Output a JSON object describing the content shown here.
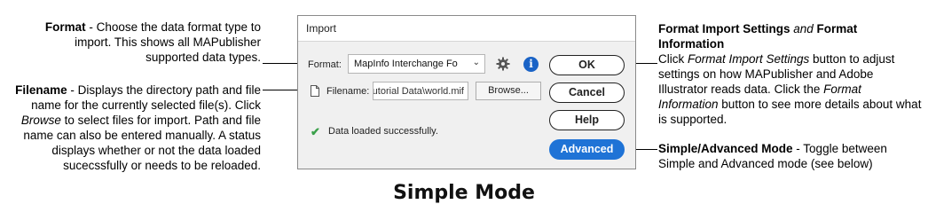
{
  "callouts": {
    "format": {
      "title": "Format",
      "text": " - Choose the data format type to import. This shows all MAPublisher supported data types."
    },
    "filename": {
      "title": "Filename",
      "text_1": " - Displays the directory path and file name for the currently selected file(s). Click ",
      "browse_em": "Browse",
      "text_2": " to select files for import. Path and file name can also be entered manually. A status displays whether or not the data loaded sucecssfully or needs to be reloaded."
    },
    "format_info": {
      "title_1": "Format Import Settings",
      "and": " and ",
      "title_2": "Format Information",
      "text_1": "Click ",
      "em_1": "Format Import Settings",
      "text_2": " button to adjust settings on how MAPublisher and Adobe Illustrator reads data. Click the ",
      "em_2": "Format Information",
      "text_3": " button to see more details about what is supported."
    },
    "mode": {
      "title": "Simple/Advanced Mode",
      "text": " - Toggle between Simple and Advanced mode (see below)"
    }
  },
  "dialog": {
    "title": "Import",
    "format_label": "Format:",
    "format_value": "MapInfo Interchange Fo",
    "filename_label": "Filename:",
    "filename_value": "utorial Data\\world.mif",
    "browse_label": "Browse...",
    "status_text": "Data loaded successfully.",
    "buttons": {
      "ok": "OK",
      "cancel": "Cancel",
      "help": "Help",
      "advanced": "Advanced"
    }
  },
  "caption": "Simple Mode",
  "icons": [
    "gear-icon",
    "info-icon",
    "file-icon",
    "checkmark-icon",
    "chevron-down-icon"
  ],
  "colors": {
    "advanced_button": "#1f73d6",
    "info_icon": "#1a63c6",
    "status_check": "#3aa04a"
  }
}
